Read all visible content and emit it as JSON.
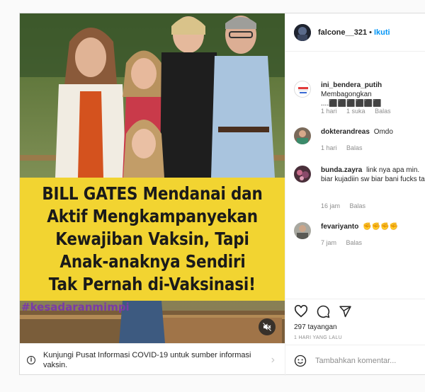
{
  "post": {
    "header": {
      "username": "falcone__321",
      "dot": "•",
      "follow_label": "Ikuti"
    },
    "media": {
      "caption_lines": [
        "BILL GATES Mendanai dan",
        "Aktif Mengkampanyekan",
        "Kewajiban Vaksin, Tapi",
        "Anak-anaknya Sendiri",
        "Tak Pernah di-Vaksinasi!"
      ],
      "hashtag": "#kesadaranmimpi",
      "caption_bg": "#f2d431"
    },
    "covid_banner": {
      "text": "Kunjungi Pusat Informasi COVID-19 untuk sumber informasi vaksin."
    },
    "comments": [
      {
        "username": "ini_bendera_putih",
        "text": "Membagongkan ....⬛⬛⬛⬛⬛⬛",
        "time": "1 hari",
        "likes": "1 suka",
        "reply": "Balas"
      },
      {
        "username": "dokterandreas",
        "text": "Omdo",
        "time": "1 hari",
        "reply": "Balas"
      },
      {
        "username": "bunda.zayra",
        "text": "link nya apa min. biar kujadiin sw biar bani fucks tau.",
        "time": "16 jam",
        "reply": "Balas"
      },
      {
        "username": "fevariyanto",
        "text": "✊✊✊✊",
        "time": "7 jam",
        "reply": "Balas"
      }
    ],
    "actions": {
      "views": "297 tayangan",
      "time_ago": "1 HARI YANG LALU"
    },
    "add_comment": {
      "placeholder": "Tambahkan komentar..."
    },
    "colors": {
      "accent": "#0095f6",
      "muted": "#8e8e8e"
    }
  }
}
